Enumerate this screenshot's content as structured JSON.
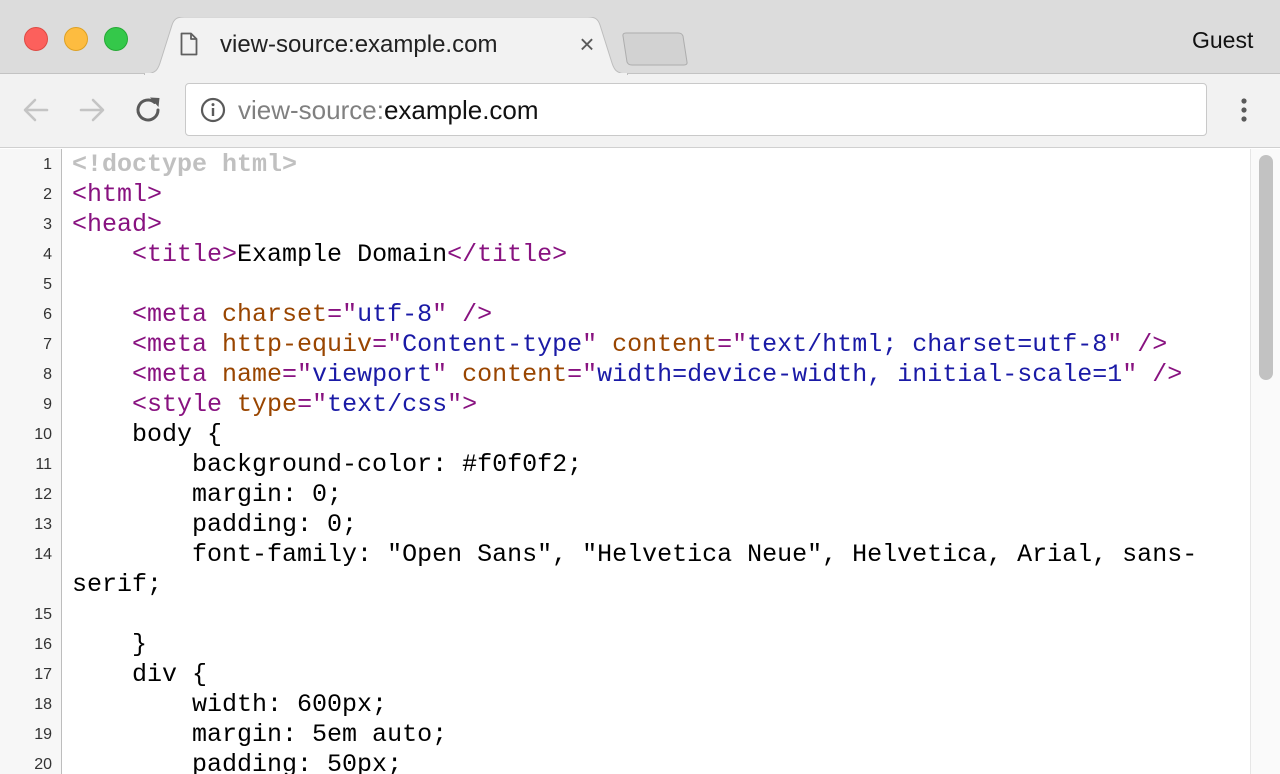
{
  "tab": {
    "title": "view-source:example.com",
    "close_glyph": "×",
    "icon": "document-icon"
  },
  "profile": {
    "label": "Guest"
  },
  "toolbar": {
    "back_icon": "back-arrow-icon",
    "forward_icon": "forward-arrow-icon",
    "reload_icon": "reload-icon",
    "menu_icon": "kebab-menu-icon",
    "url_scheme": "view-source:",
    "url_host": "example.com",
    "security_icon": "info-icon"
  },
  "colors": {
    "tag": "#881280",
    "attribute": "#994500",
    "value": "#1a1aa6",
    "doctype": "#c0c0c0",
    "text": "#000000"
  },
  "source": {
    "lines": [
      {
        "num": "1",
        "tokens": [
          {
            "t": "doctype",
            "v": "<!doctype html>"
          }
        ]
      },
      {
        "num": "2",
        "tokens": [
          {
            "t": "tag",
            "v": "<html>"
          }
        ]
      },
      {
        "num": "3",
        "tokens": [
          {
            "t": "tag",
            "v": "<head>"
          }
        ]
      },
      {
        "num": "4",
        "tokens": [
          {
            "t": "text",
            "v": "    "
          },
          {
            "t": "tag",
            "v": "<title>"
          },
          {
            "t": "text",
            "v": "Example Domain"
          },
          {
            "t": "tag",
            "v": "</title>"
          }
        ]
      },
      {
        "num": "5",
        "tokens": []
      },
      {
        "num": "6",
        "tokens": [
          {
            "t": "text",
            "v": "    "
          },
          {
            "t": "tag",
            "v": "<meta "
          },
          {
            "t": "attr",
            "v": "charset"
          },
          {
            "t": "tag",
            "v": "=\""
          },
          {
            "t": "val",
            "v": "utf-8"
          },
          {
            "t": "tag",
            "v": "\" />"
          }
        ]
      },
      {
        "num": "7",
        "tokens": [
          {
            "t": "text",
            "v": "    "
          },
          {
            "t": "tag",
            "v": "<meta "
          },
          {
            "t": "attr",
            "v": "http-equiv"
          },
          {
            "t": "tag",
            "v": "=\""
          },
          {
            "t": "val",
            "v": "Content-type"
          },
          {
            "t": "tag",
            "v": "\" "
          },
          {
            "t": "attr",
            "v": "content"
          },
          {
            "t": "tag",
            "v": "=\""
          },
          {
            "t": "val",
            "v": "text/html; charset=utf-8"
          },
          {
            "t": "tag",
            "v": "\" />"
          }
        ]
      },
      {
        "num": "8",
        "tokens": [
          {
            "t": "text",
            "v": "    "
          },
          {
            "t": "tag",
            "v": "<meta "
          },
          {
            "t": "attr",
            "v": "name"
          },
          {
            "t": "tag",
            "v": "=\""
          },
          {
            "t": "val",
            "v": "viewport"
          },
          {
            "t": "tag",
            "v": "\" "
          },
          {
            "t": "attr",
            "v": "content"
          },
          {
            "t": "tag",
            "v": "=\""
          },
          {
            "t": "val",
            "v": "width=device-width, initial-scale=1"
          },
          {
            "t": "tag",
            "v": "\" />"
          }
        ]
      },
      {
        "num": "9",
        "tokens": [
          {
            "t": "text",
            "v": "    "
          },
          {
            "t": "tag",
            "v": "<style "
          },
          {
            "t": "attr",
            "v": "type"
          },
          {
            "t": "tag",
            "v": "=\""
          },
          {
            "t": "val",
            "v": "text/css"
          },
          {
            "t": "tag",
            "v": "\">"
          }
        ]
      },
      {
        "num": "10",
        "tokens": [
          {
            "t": "text",
            "v": "    body {"
          }
        ]
      },
      {
        "num": "11",
        "tokens": [
          {
            "t": "text",
            "v": "        background-color: #f0f0f2;"
          }
        ]
      },
      {
        "num": "12",
        "tokens": [
          {
            "t": "text",
            "v": "        margin: 0;"
          }
        ]
      },
      {
        "num": "13",
        "tokens": [
          {
            "t": "text",
            "v": "        padding: 0;"
          }
        ]
      },
      {
        "num": "14",
        "wrap": true,
        "tokens": [
          {
            "t": "text",
            "v": "        font-family: \"Open Sans\", \"Helvetica Neue\", Helvetica, Arial, sans-serif;"
          }
        ]
      },
      {
        "num": "15",
        "tokens": [
          {
            "t": "text",
            "v": "        "
          }
        ]
      },
      {
        "num": "16",
        "tokens": [
          {
            "t": "text",
            "v": "    }"
          }
        ]
      },
      {
        "num": "17",
        "tokens": [
          {
            "t": "text",
            "v": "    div {"
          }
        ]
      },
      {
        "num": "18",
        "tokens": [
          {
            "t": "text",
            "v": "        width: 600px;"
          }
        ]
      },
      {
        "num": "19",
        "tokens": [
          {
            "t": "text",
            "v": "        margin: 5em auto;"
          }
        ]
      },
      {
        "num": "20",
        "tokens": [
          {
            "t": "text",
            "v": "        padding: 50px;"
          }
        ]
      }
    ]
  }
}
